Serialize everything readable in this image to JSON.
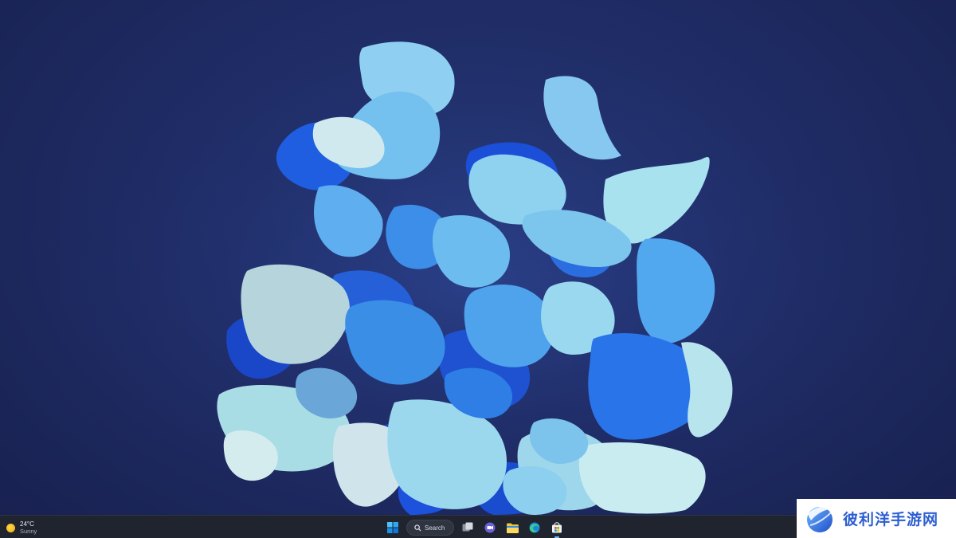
{
  "desktop": {
    "wallpaper": "blue-petal-bloom",
    "background_color": "#1f2c66"
  },
  "taskbar": {
    "weather": {
      "temperature": "24°C",
      "condition": "Sunny",
      "icon": "sun-icon"
    },
    "start_icon": "windows-start-icon",
    "search_label": "Search",
    "pinned_apps": [
      {
        "name": "task-view",
        "icon": "task-view-icon"
      },
      {
        "name": "chat",
        "icon": "chat-icon"
      },
      {
        "name": "file-explorer",
        "icon": "folder-icon"
      },
      {
        "name": "edge",
        "icon": "edge-icon"
      },
      {
        "name": "microsoft-store",
        "icon": "store-icon"
      }
    ],
    "accent_color": "#0078d4"
  },
  "watermark": {
    "text": "彼利洋手游网",
    "color": "#2d5fd0"
  }
}
